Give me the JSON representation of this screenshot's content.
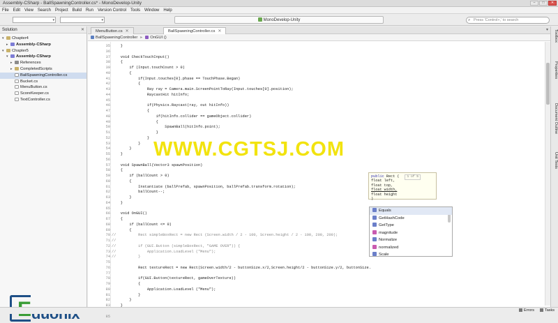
{
  "window": {
    "title": "Assembly-CSharp - BallSpawningController.cs* - MonoDevelop-Unity",
    "min": "–",
    "max": "□",
    "close": "✕"
  },
  "menu": [
    "File",
    "Edit",
    "View",
    "Search",
    "Project",
    "Build",
    "Run",
    "Version Control",
    "Tools",
    "Window",
    "Help"
  ],
  "toolbar": {
    "status": "MonoDevelop-Unity",
    "search_placeholder": "Press 'Control+,' to search"
  },
  "solution": {
    "title": "Solution",
    "close": "✕",
    "items": [
      {
        "label": "Chapter4",
        "indent": 0,
        "expander": "▾",
        "icon": "folder",
        "bold": false,
        "sel": false
      },
      {
        "label": "Assembly-CSharp",
        "indent": 1,
        "expander": "▸",
        "icon": "proj",
        "bold": true,
        "sel": false
      },
      {
        "label": "Chapter5",
        "indent": 0,
        "expander": "▾",
        "icon": "folder",
        "bold": false,
        "sel": false
      },
      {
        "label": "Assembly-CSharp",
        "indent": 1,
        "expander": "▾",
        "icon": "proj",
        "bold": true,
        "sel": false
      },
      {
        "label": "References",
        "indent": 2,
        "expander": "▸",
        "icon": "ref",
        "bold": false,
        "sel": false
      },
      {
        "label": "CompletedScripts",
        "indent": 2,
        "expander": "▸",
        "icon": "folder",
        "bold": false,
        "sel": false
      },
      {
        "label": "BallSpawningController.cs",
        "indent": 2,
        "expander": "",
        "icon": "file",
        "bold": false,
        "sel": true
      },
      {
        "label": "Bucket.cs",
        "indent": 2,
        "expander": "",
        "icon": "file",
        "bold": false,
        "sel": false
      },
      {
        "label": "MenuButton.cs",
        "indent": 2,
        "expander": "",
        "icon": "file",
        "bold": false,
        "sel": false
      },
      {
        "label": "ScoreKeeper.cs",
        "indent": 2,
        "expander": "",
        "icon": "file",
        "bold": false,
        "sel": false
      },
      {
        "label": "TextController.cs",
        "indent": 2,
        "expander": "",
        "icon": "file",
        "bold": false,
        "sel": false
      }
    ]
  },
  "logo": {
    "e": "E",
    "rest": "duonix"
  },
  "tabs": [
    {
      "label": "MenuButton.cs",
      "active": false
    },
    {
      "label": "BallSpawningController.cs",
      "active": true
    }
  ],
  "tab_close": "✕",
  "pathbar": {
    "class": "BallSpawningController",
    "method": "OnGUI ()"
  },
  "code": [
    {
      "n": "35",
      "t": "    }"
    },
    {
      "n": "36",
      "t": ""
    },
    {
      "n": "37",
      "t": "    void CheckTouchInput()"
    },
    {
      "n": "38",
      "t": "    {"
    },
    {
      "n": "39",
      "t": "        if (Input.touchCount > 0)"
    },
    {
      "n": "40",
      "t": "        {"
    },
    {
      "n": "41",
      "t": "            if(Input.touches[0].phase == TouchPhase.Began)"
    },
    {
      "n": "42",
      "t": "            {"
    },
    {
      "n": "43",
      "t": "                Ray ray = Camera.main.ScreenPointToRay(Input.touches[0].position);"
    },
    {
      "n": "44",
      "t": "                RaycastHit hitInfo;"
    },
    {
      "n": "45",
      "t": ""
    },
    {
      "n": "46",
      "t": "                if(Physics.Raycast(ray, out hitInfo))"
    },
    {
      "n": "47",
      "t": "                {"
    },
    {
      "n": "48",
      "t": "                    if(hitInfo.collider == gameObject.collider)"
    },
    {
      "n": "49",
      "t": "                    {"
    },
    {
      "n": "50",
      "t": "                        SpawnBall(hitInfo.point);"
    },
    {
      "n": "51",
      "t": "                    }"
    },
    {
      "n": "52",
      "t": "                }"
    },
    {
      "n": "53",
      "t": "            }"
    },
    {
      "n": "54",
      "t": "        }"
    },
    {
      "n": "55",
      "t": "    }"
    },
    {
      "n": "56",
      "t": ""
    },
    {
      "n": "57",
      "t": "    void SpawnBall(Vector3 spawnPosition)"
    },
    {
      "n": "58",
      "t": "    {"
    },
    {
      "n": "59",
      "t": "        if (ballCount > 0)"
    },
    {
      "n": "60",
      "t": "        {"
    },
    {
      "n": "61",
      "t": "            Instantiate (ballPrefab, spawnPosition, ballPrefab.transform.rotation);"
    },
    {
      "n": "62",
      "t": "            ballCount--;"
    },
    {
      "n": "63",
      "t": "        }"
    },
    {
      "n": "64",
      "t": "    }"
    },
    {
      "n": "65",
      "t": ""
    },
    {
      "n": "66",
      "t": "    void OnGUI()"
    },
    {
      "n": "67",
      "t": "    {"
    },
    {
      "n": "68",
      "t": "        if (ballCount <= 0)"
    },
    {
      "n": "69",
      "t": "        {"
    },
    {
      "n": "70",
      "t": "//          Rect simpleBoxRect = new Rect (Screen.width / 2 - 100, Screen.height / 2 - 100, 200, 200);"
    },
    {
      "n": "71",
      "t": "//"
    },
    {
      "n": "72",
      "t": "//          if (GUI.Button (simpleBoxRect, \"GAME OVER\")) {"
    },
    {
      "n": "73",
      "t": "//              Application.LoadLevel (\"Menu\");"
    },
    {
      "n": "74",
      "t": "//          }"
    },
    {
      "n": "75",
      "t": ""
    },
    {
      "n": "76",
      "t": "            Rect textureRect = new Rect(Screen.width/2 - buttonSize.x/2,Screen.height/2 - buttonSize.y/2, buttonSize."
    },
    {
      "n": "77",
      "t": ""
    },
    {
      "n": "78",
      "t": "            if(GUI.Button(textureRect, gameOverTexture))"
    },
    {
      "n": "79",
      "t": "            {"
    },
    {
      "n": "80",
      "t": "                Application.LoadLevel (\"Menu\");"
    },
    {
      "n": "81",
      "t": "            }"
    },
    {
      "n": "82",
      "t": "        }"
    },
    {
      "n": "83",
      "t": "    }"
    },
    {
      "n": "84",
      "t": "}"
    },
    {
      "n": "85",
      "t": ""
    }
  ],
  "watermark": "WWW.CGTSJ.COM",
  "param_tip": {
    "page": "1 of 5",
    "lines": [
      "public Rect (",
      "  float left,",
      "  float top,",
      "  float width,",
      "  float height",
      ")"
    ]
  },
  "completion": [
    {
      "label": "Equals",
      "color": "#6b7fc9",
      "sel": true
    },
    {
      "label": "GetHashCode",
      "color": "#6b7fc9",
      "sel": false
    },
    {
      "label": "GetType",
      "color": "#6b7fc9",
      "sel": false
    },
    {
      "label": "magnitude",
      "color": "#c95bb0",
      "sel": false
    },
    {
      "label": "Normalize",
      "color": "#6b7fc9",
      "sel": false
    },
    {
      "label": "normalized",
      "color": "#c95bb0",
      "sel": false
    },
    {
      "label": "Scale",
      "color": "#6b7fc9",
      "sel": false
    }
  ],
  "rightbar": [
    "Toolbox",
    "Properties",
    "Document Outline",
    "Unit Tests"
  ],
  "status": {
    "errors": "Errors",
    "tasks": "Tasks"
  }
}
